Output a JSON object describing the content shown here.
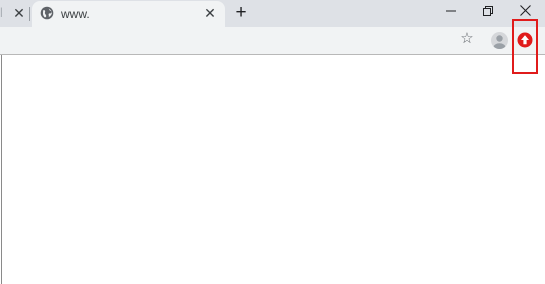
{
  "browser": {
    "tab": {
      "title": "www.",
      "close_glyph": "✕",
      "favicon": "globe-icon"
    },
    "previous_tab": {
      "close_glyph": "✕"
    },
    "new_tab_glyph": "+",
    "window": {
      "minimize_glyph": "─",
      "restore_glyph": "❐",
      "close_glyph": "✕"
    },
    "toolbar": {
      "bookmark_glyph": "☆",
      "profile_icon": "profile-avatar-icon",
      "extension_icon": "red-extension-icon"
    }
  },
  "colors": {
    "tab_strip": "#dee1e6",
    "active_tab": "#f1f3f4",
    "extension_red": "#e01b1b",
    "highlight_box": "#e01b1b"
  }
}
